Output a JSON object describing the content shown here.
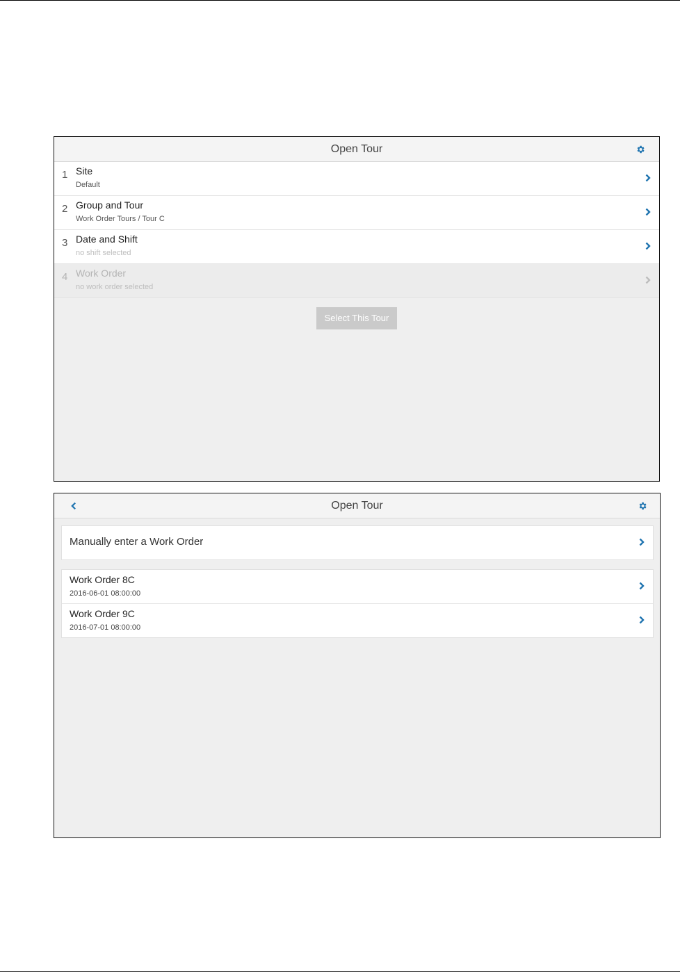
{
  "screen1": {
    "title": "Open Tour",
    "steps": [
      {
        "number": "1",
        "title": "Site",
        "subtitle": "Default"
      },
      {
        "number": "2",
        "title": "Group and Tour",
        "subtitle": "Work Order Tours / Tour C"
      },
      {
        "number": "3",
        "title": "Date and Shift",
        "subtitle": "no shift selected"
      },
      {
        "number": "4",
        "title": "Work Order",
        "subtitle": "no work order selected"
      }
    ],
    "select_button": "Select This Tour"
  },
  "screen2": {
    "title": "Open Tour",
    "manual_entry": "Manually enter a Work Order",
    "work_orders": [
      {
        "name": "Work Order 8C",
        "datetime": "2016-06-01 08:00:00"
      },
      {
        "name": "Work Order 9C",
        "datetime": "2016-07-01 08:00:00"
      }
    ]
  },
  "colors": {
    "accent": "#1f74b0",
    "background": "#efefef",
    "disabled_text": "#b4b4b4"
  },
  "icons": {
    "settings": "gear-icon",
    "back": "chevron-left-icon",
    "forward": "chevron-right-icon"
  }
}
